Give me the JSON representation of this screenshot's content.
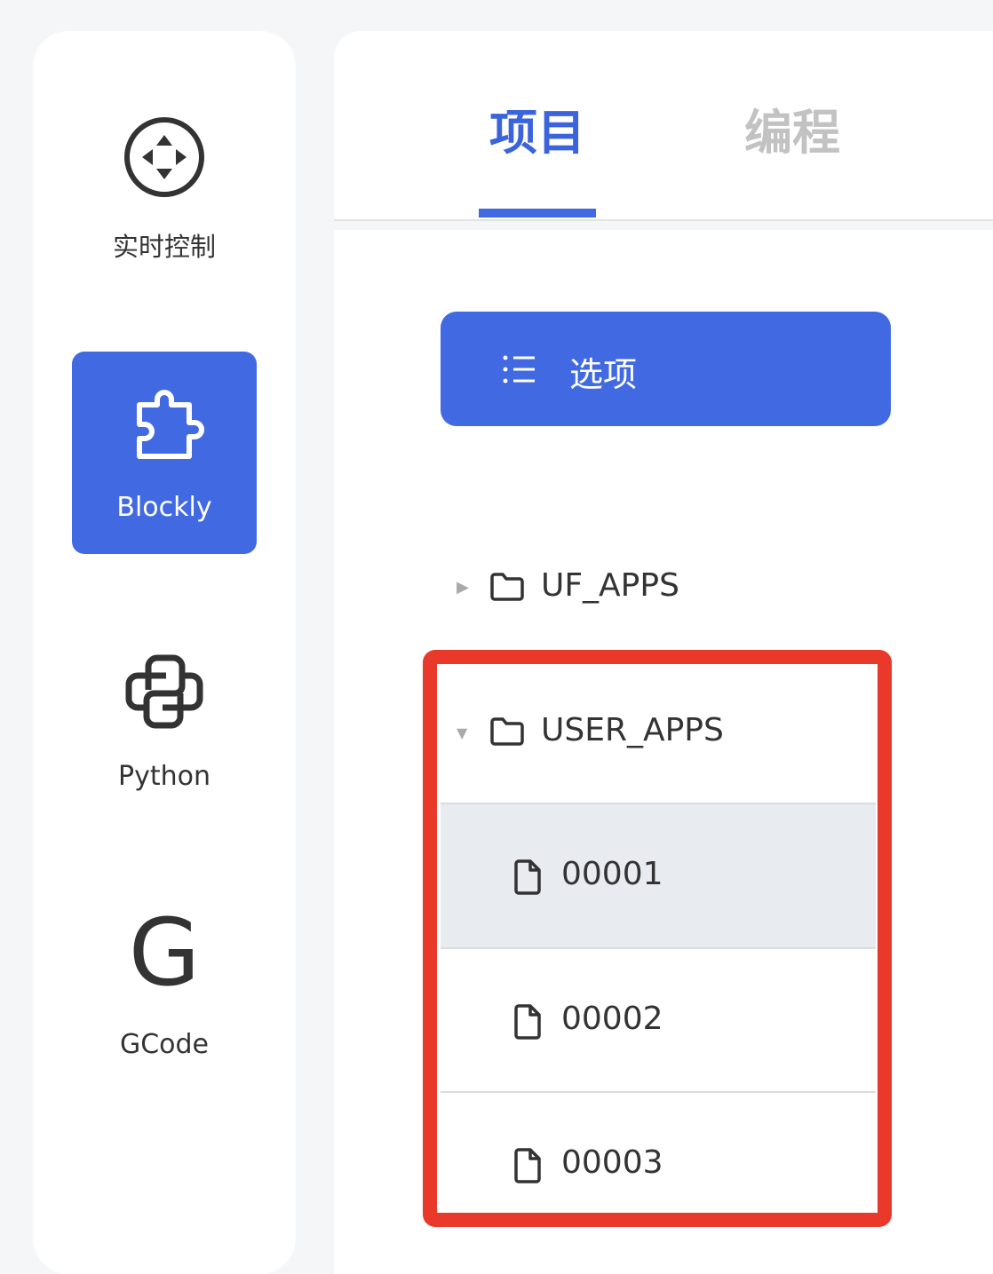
{
  "sidebar": {
    "items": [
      {
        "label": "实时控制",
        "icon": "move-control-icon",
        "active": false
      },
      {
        "label": "Blockly",
        "icon": "puzzle-icon",
        "active": true
      },
      {
        "label": "Python",
        "icon": "python-icon",
        "active": false
      },
      {
        "label": "GCode",
        "icon": "gcode-icon",
        "glyph": "G",
        "active": false
      }
    ]
  },
  "tabs": [
    {
      "label": "项目",
      "active": true
    },
    {
      "label": "编程",
      "active": false
    }
  ],
  "options_button": {
    "label": "选项",
    "icon": "list-icon"
  },
  "tree": {
    "folders": [
      {
        "name": "UF_APPS",
        "expanded": false
      },
      {
        "name": "USER_APPS",
        "expanded": true
      }
    ],
    "files": [
      {
        "name": "00001",
        "selected": true
      },
      {
        "name": "00002",
        "selected": false
      },
      {
        "name": "00003",
        "selected": false
      }
    ]
  },
  "colors": {
    "accent": "#4169e1",
    "highlight_border": "#e8392a",
    "selected_row": "#e8ebf0",
    "inactive_tab": "#c2c2c2"
  }
}
